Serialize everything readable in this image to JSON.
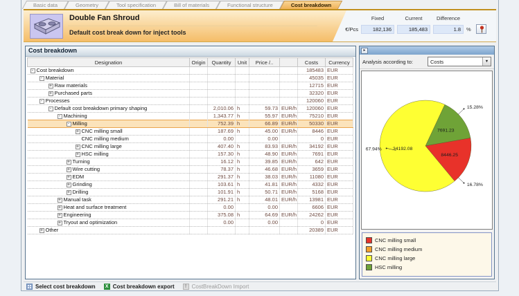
{
  "tabs": [
    {
      "label": "Basic data",
      "active": false
    },
    {
      "label": "Geometry",
      "active": false
    },
    {
      "label": "Tool specification",
      "active": false
    },
    {
      "label": "Bill of materials",
      "active": false
    },
    {
      "label": "Functional structure",
      "active": false
    },
    {
      "label": "Cost breakdown",
      "active": true
    }
  ],
  "header": {
    "title": "Double Fan Shroud",
    "subtitle": "Default cost break down for inject tools",
    "unit_label": "€/Pcs",
    "percent_label": "%",
    "metrics": [
      {
        "label": "Fixed",
        "value": "182,136"
      },
      {
        "label": "Current",
        "value": "185,483"
      },
      {
        "label": "Difference",
        "value": "1.8"
      }
    ]
  },
  "left_panel": {
    "title": "Cost breakdown",
    "columns": [
      "Designation",
      "Origin",
      "Quantity",
      "Unit",
      "Price /..",
      "",
      "Costs",
      "Currency"
    ],
    "rows": [
      {
        "level": 0,
        "toggle": "minus",
        "designation": "Cost breakdown",
        "origin": "",
        "quantity": "",
        "unit": "",
        "price": "",
        "price_unit": "",
        "costs": "185483",
        "currency": "EUR",
        "highlight": false
      },
      {
        "level": 1,
        "toggle": "minus",
        "designation": "Material",
        "origin": "",
        "quantity": "",
        "unit": "",
        "price": "",
        "price_unit": "",
        "costs": "45035",
        "currency": "EUR",
        "highlight": false
      },
      {
        "level": 2,
        "toggle": "plus",
        "designation": "Raw materials",
        "origin": "",
        "quantity": "",
        "unit": "",
        "price": "",
        "price_unit": "",
        "costs": "12715",
        "currency": "EUR",
        "highlight": false
      },
      {
        "level": 2,
        "toggle": "plus",
        "designation": "Purchased parts",
        "origin": "",
        "quantity": "",
        "unit": "",
        "price": "",
        "price_unit": "",
        "costs": "32320",
        "currency": "EUR",
        "highlight": false
      },
      {
        "level": 1,
        "toggle": "minus",
        "designation": "Processes",
        "origin": "",
        "quantity": "",
        "unit": "",
        "price": "",
        "price_unit": "",
        "costs": "120060",
        "currency": "EUR",
        "highlight": false
      },
      {
        "level": 2,
        "toggle": "minus",
        "designation": "Default cost breakdown primary shaping",
        "origin": "",
        "quantity": "2,010.06",
        "unit": "h",
        "price": "59.73",
        "price_unit": "EUR/h",
        "costs": "120060",
        "currency": "EUR",
        "highlight": false
      },
      {
        "level": 3,
        "toggle": "minus",
        "designation": "Machining",
        "origin": "",
        "quantity": "1,343.77",
        "unit": "h",
        "price": "55.97",
        "price_unit": "EUR/h",
        "costs": "75210",
        "currency": "EUR",
        "highlight": false
      },
      {
        "level": 4,
        "toggle": "minus",
        "designation": "Milling",
        "origin": "",
        "quantity": "752.39",
        "unit": "h",
        "price": "66.89",
        "price_unit": "EUR/h",
        "costs": "50330",
        "currency": "EUR",
        "highlight": true
      },
      {
        "level": 5,
        "toggle": "plus",
        "designation": "CNC milling small",
        "origin": "",
        "quantity": "187.69",
        "unit": "h",
        "price": "45.00",
        "price_unit": "EUR/h",
        "costs": "8446",
        "currency": "EUR",
        "highlight": false
      },
      {
        "level": 5,
        "toggle": "none",
        "designation": "CNC milling medium",
        "origin": "",
        "quantity": "0.00",
        "unit": "",
        "price": "0.00",
        "price_unit": "",
        "costs": "0",
        "currency": "EUR",
        "highlight": false
      },
      {
        "level": 5,
        "toggle": "plus",
        "designation": "CNC milling large",
        "origin": "",
        "quantity": "407.40",
        "unit": "h",
        "price": "83.93",
        "price_unit": "EUR/h",
        "costs": "34192",
        "currency": "EUR",
        "highlight": false
      },
      {
        "level": 5,
        "toggle": "plus",
        "designation": "HSC milling",
        "origin": "",
        "quantity": "157.30",
        "unit": "h",
        "price": "48.90",
        "price_unit": "EUR/h",
        "costs": "7691",
        "currency": "EUR",
        "highlight": false
      },
      {
        "level": 4,
        "toggle": "plus",
        "designation": "Turning",
        "origin": "",
        "quantity": "16.12",
        "unit": "h",
        "price": "39.85",
        "price_unit": "EUR/h",
        "costs": "642",
        "currency": "EUR",
        "highlight": false
      },
      {
        "level": 4,
        "toggle": "plus",
        "designation": "Wire cutting",
        "origin": "",
        "quantity": "78.37",
        "unit": "h",
        "price": "46.68",
        "price_unit": "EUR/h",
        "costs": "3659",
        "currency": "EUR",
        "highlight": false
      },
      {
        "level": 4,
        "toggle": "plus",
        "designation": "EDM",
        "origin": "",
        "quantity": "291.37",
        "unit": "h",
        "price": "38.03",
        "price_unit": "EUR/h",
        "costs": "11080",
        "currency": "EUR",
        "highlight": false
      },
      {
        "level": 4,
        "toggle": "plus",
        "designation": "Grinding",
        "origin": "",
        "quantity": "103.61",
        "unit": "h",
        "price": "41.81",
        "price_unit": "EUR/h",
        "costs": "4332",
        "currency": "EUR",
        "highlight": false
      },
      {
        "level": 4,
        "toggle": "plus",
        "designation": "Drilling",
        "origin": "",
        "quantity": "101.91",
        "unit": "h",
        "price": "50.71",
        "price_unit": "EUR/h",
        "costs": "5168",
        "currency": "EUR",
        "highlight": false
      },
      {
        "level": 3,
        "toggle": "plus",
        "designation": "Manual task",
        "origin": "",
        "quantity": "291.21",
        "unit": "h",
        "price": "48.01",
        "price_unit": "EUR/h",
        "costs": "13981",
        "currency": "EUR",
        "highlight": false
      },
      {
        "level": 3,
        "toggle": "plus",
        "designation": "Heat and surface treatment",
        "origin": "",
        "quantity": "0.00",
        "unit": "",
        "price": "0.00",
        "price_unit": "",
        "costs": "6606",
        "currency": "EUR",
        "highlight": false
      },
      {
        "level": 3,
        "toggle": "plus",
        "designation": "Engineering",
        "origin": "",
        "quantity": "375.08",
        "unit": "h",
        "price": "64.69",
        "price_unit": "EUR/h",
        "costs": "24262",
        "currency": "EUR",
        "highlight": false
      },
      {
        "level": 3,
        "toggle": "plus",
        "designation": "Tryout and optimization",
        "origin": "",
        "quantity": "0.00",
        "unit": "",
        "price": "0.00",
        "price_unit": "",
        "costs": "0",
        "currency": "EUR",
        "highlight": false
      },
      {
        "level": 1,
        "toggle": "plus",
        "designation": "Other",
        "origin": "",
        "quantity": "",
        "unit": "",
        "price": "",
        "price_unit": "",
        "costs": "20389",
        "currency": "EUR",
        "highlight": false
      }
    ]
  },
  "right_panel": {
    "analysis_label": "Analysis according to:",
    "analysis_value": "Costs",
    "chart_data": {
      "type": "pie",
      "title": "",
      "start_angle": 65,
      "direction": "clockwise",
      "legend_position": "bottom",
      "slices": [
        {
          "name": "HSC milling",
          "value": 7691.23,
          "pct": 15.28,
          "value_label": "7691.23",
          "pct_label": "15.28%",
          "color": "#6fa337",
          "pct_angle": 44
        },
        {
          "name": "CNC milling small",
          "value": 8446.25,
          "pct": 16.78,
          "value_label": "8446.25",
          "pct_label": "16.78%",
          "color": "#e8322a",
          "pct_angle": -44
        },
        {
          "name": "CNC milling large",
          "value": 34192.08,
          "pct": 67.94,
          "value_label": "34192.08",
          "pct_label": "67.94%",
          "color": "#feff33",
          "label_angle": 187,
          "label_r": 0.5,
          "pct_angle": 183
        },
        {
          "name": "CNC milling medium",
          "value": 0,
          "pct": 0,
          "color": "#f5a02c"
        }
      ],
      "legend": [
        {
          "label": "CNC milling small",
          "color": "#e8322a"
        },
        {
          "label": "CNC milling medium",
          "color": "#f5a02c"
        },
        {
          "label": "CNC milling large",
          "color": "#feff33"
        },
        {
          "label": "HSC milling",
          "color": "#6fa337"
        }
      ]
    }
  },
  "toolbar": {
    "items": [
      {
        "label": "Select cost breakdown",
        "icon": "table-icon",
        "disabled": false
      },
      {
        "label": "Cost breakdown export",
        "icon": "excel-icon",
        "disabled": false
      },
      {
        "label": "CostBreakDown Import",
        "icon": "import-icon",
        "disabled": true
      }
    ]
  }
}
